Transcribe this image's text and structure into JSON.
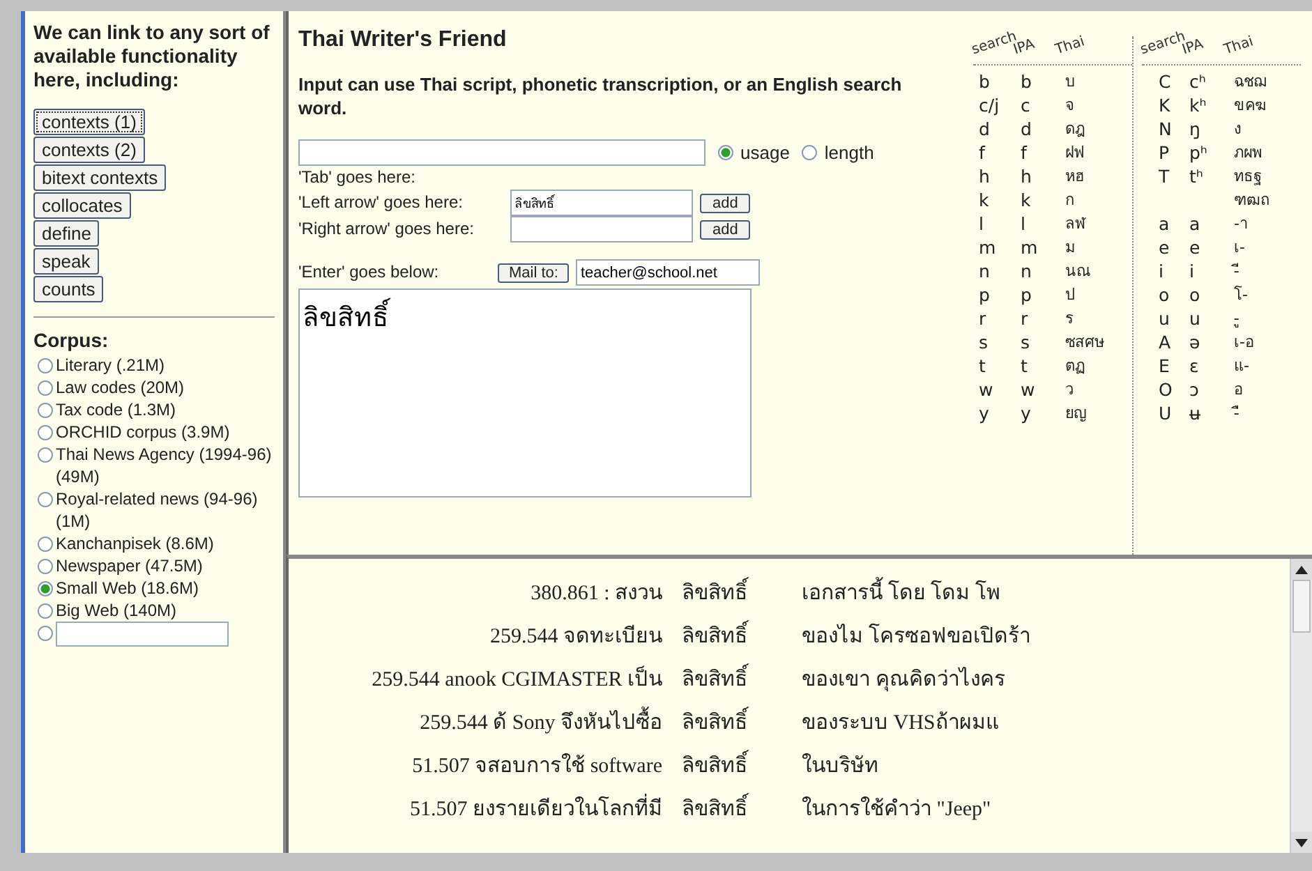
{
  "sidebar": {
    "intro": "We can link to any sort of available functionality here, including:",
    "buttons": [
      {
        "label": "contexts (1)",
        "focused": true
      },
      {
        "label": "contexts (2)",
        "focused": false
      },
      {
        "label": "bitext contexts",
        "focused": false
      },
      {
        "label": "collocates",
        "focused": false
      },
      {
        "label": "define",
        "focused": false
      },
      {
        "label": "speak",
        "focused": false
      },
      {
        "label": "counts",
        "focused": false
      }
    ],
    "corpus_heading": "Corpus:",
    "corpora": [
      {
        "label": "Literary (.21M)",
        "selected": false
      },
      {
        "label": "Law codes (20M)",
        "selected": false
      },
      {
        "label": "Tax code (1.3M)",
        "selected": false
      },
      {
        "label": "ORCHID corpus (3.9M)",
        "selected": false
      },
      {
        "label": "Thai News Agency (1994-96) (49M)",
        "selected": false
      },
      {
        "label": "Royal-related news (94-96) (1M)",
        "selected": false
      },
      {
        "label": "Kanchanpisek (8.6M)",
        "selected": false
      },
      {
        "label": "Newspaper (47.5M)",
        "selected": false
      },
      {
        "label": "Small Web (18.6M)",
        "selected": true
      },
      {
        "label": "Big Web (140M)",
        "selected": false
      },
      {
        "kind": "custom",
        "selected": false
      }
    ]
  },
  "main": {
    "title": "Thai Writer's Friend",
    "subtitle": "Input can use Thai script, phonetic transcription, or an English search word.",
    "modes": [
      {
        "label": "usage",
        "selected": true
      },
      {
        "label": "length",
        "selected": false
      }
    ],
    "tab_label": "'Tab' goes here:",
    "left_label": "'Left arrow' goes here:",
    "left_value": "ลิขสิทธิ์",
    "left_button": "add",
    "right_label": "'Right arrow' goes here:",
    "right_button": "add",
    "enter_label": "'Enter' goes below:",
    "mail_button": "Mail to:",
    "mail_value": "teacher@school.net",
    "text_value": "ลิขสิทธิ์"
  },
  "key": {
    "groups": [
      {
        "headers": [
          "search",
          "IPA",
          "Thai"
        ],
        "rows": [
          {
            "search": "b",
            "ipa": "b",
            "thai": "บ"
          },
          {
            "search": "c/j",
            "ipa": "c",
            "thai": "จ"
          },
          {
            "search": "d",
            "ipa": "d",
            "thai": "ดฎ"
          },
          {
            "search": "f",
            "ipa": "f",
            "thai": "ฝฟ"
          },
          {
            "search": "h",
            "ipa": "h",
            "thai": "หฮ"
          },
          {
            "search": "k",
            "ipa": "k",
            "thai": "ก"
          },
          {
            "search": "l",
            "ipa": "l",
            "thai": "ลฬ"
          },
          {
            "search": "m",
            "ipa": "m",
            "thai": "ม"
          },
          {
            "search": "n",
            "ipa": "n",
            "thai": "นณ"
          },
          {
            "search": "p",
            "ipa": "p",
            "thai": "ป"
          },
          {
            "search": "r",
            "ipa": "r",
            "thai": "ร"
          },
          {
            "search": "s",
            "ipa": "s",
            "thai": "ซสศษ"
          },
          {
            "search": "t",
            "ipa": "t",
            "thai": "ตฏ"
          },
          {
            "search": "w",
            "ipa": "w",
            "thai": "ว"
          },
          {
            "search": "y",
            "ipa": "y",
            "thai": "ยญ"
          }
        ]
      },
      {
        "headers": [
          "search",
          "IPA",
          "Thai"
        ],
        "rows": [
          {
            "search": "C",
            "ipa": "cʰ",
            "thai": "ฉชฌ"
          },
          {
            "search": "K",
            "ipa": "kʰ",
            "thai": "ขคฆ"
          },
          {
            "search": "N",
            "ipa": "ŋ",
            "thai": "ง"
          },
          {
            "search": "P",
            "ipa": "pʰ",
            "thai": "ภผพ"
          },
          {
            "search": "T",
            "ipa": "tʰ",
            "thai": "ทธฐ"
          },
          {
            "thai": "ฑฒถ"
          },
          {
            "search": "a",
            "ipa": "a",
            "thai": "-า"
          },
          {
            "search": "e",
            "ipa": "e",
            "thai": "เ-"
          },
          {
            "search": "i",
            "ipa": "i",
            "thai": "-ี"
          },
          {
            "search": "o",
            "ipa": "o",
            "thai": "โ-"
          },
          {
            "search": "u",
            "ipa": "u",
            "thai": "-ู"
          },
          {
            "search": "A",
            "ipa": "ə",
            "thai": "เ-อ"
          },
          {
            "search": "E",
            "ipa": "ɛ",
            "thai": "แ-"
          },
          {
            "search": "O",
            "ipa": "ɔ",
            "thai": "อ"
          },
          {
            "search": "U",
            "ipa": "ʉ",
            "thai": "-ื"
          }
        ]
      }
    ]
  },
  "concordance": [
    {
      "left": "380.861 : สงวน",
      "keyword": "ลิขสิทธิ์",
      "right": "เอกสารนี้ โดย โดม โพ"
    },
    {
      "left": "259.544 จดทะเบียน",
      "keyword": "ลิขสิทธิ์",
      "right": "ของไม โครซอฟขอเปิดร้า"
    },
    {
      "left": "259.544 anook CGIMASTER เป็น",
      "keyword": "ลิขสิทธิ์",
      "right": "ของเขา คุณคิดว่าไงคร"
    },
    {
      "left": "259.544 ด้ Sony จึงหันไปซื้อ",
      "keyword": "ลิขสิทธิ์",
      "right": "ของระบบ VHSถ้าผมแ"
    },
    {
      "left": "51.507 จสอบการใช้ software",
      "keyword": "ลิขสิทธิ์",
      "right": "ในบริษัท"
    },
    {
      "left": "51.507 ยงรายเดียวในโลกที่มี",
      "keyword": "ลิขสิทธิ์",
      "right": "ในการใช้คำว่า \"Jeep\""
    }
  ]
}
